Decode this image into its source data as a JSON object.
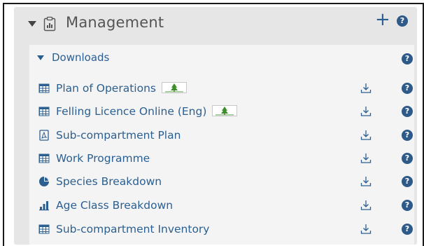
{
  "panel": {
    "title": "Management",
    "add_label": "+",
    "help_label": "?"
  },
  "downloads": {
    "title": "Downloads",
    "help_label": "?",
    "items": [
      {
        "label": "Plan of Operations",
        "icon": "table-icon",
        "badge": true
      },
      {
        "label": "Felling Licence Online (Eng)",
        "icon": "table-icon",
        "badge": true
      },
      {
        "label": "Sub-compartment Plan",
        "icon": "pdf-icon",
        "badge": false
      },
      {
        "label": "Work Programme",
        "icon": "table-icon",
        "badge": false
      },
      {
        "label": "Species Breakdown",
        "icon": "pie-chart-icon",
        "badge": false
      },
      {
        "label": "Age Class Breakdown",
        "icon": "bar-chart-icon",
        "badge": false
      },
      {
        "label": "Sub-compartment Inventory",
        "icon": "table-icon",
        "badge": false
      }
    ]
  },
  "colors": {
    "link": "#2b5f91",
    "help_bg": "#2d5a88",
    "panel_bg": "#e6e6e6",
    "section_bg": "#f4f4f4",
    "badge_green": "#3a8f2a"
  }
}
